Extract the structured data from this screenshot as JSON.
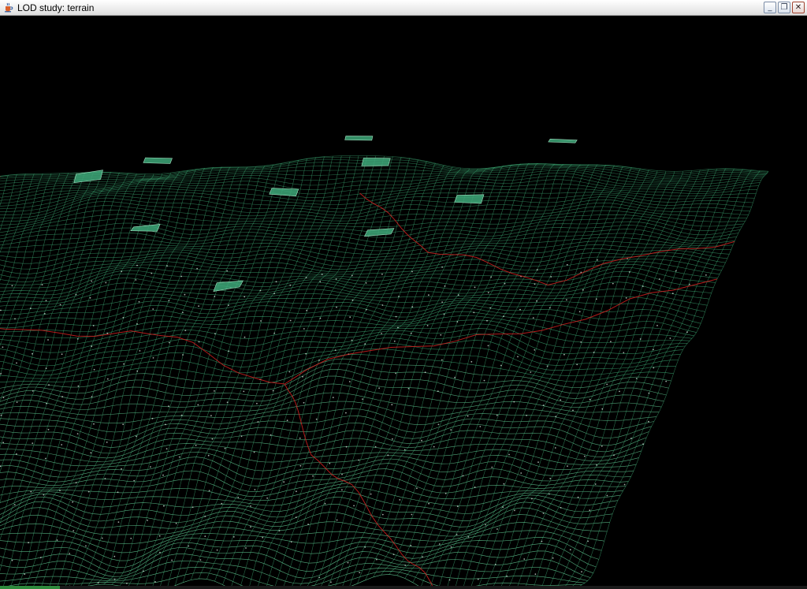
{
  "window": {
    "title": "LOD study: terrain",
    "controls": {
      "minimize_glyph": "_",
      "maximize_glyph": "❐",
      "close_glyph": "✕"
    }
  },
  "icons": {
    "app": "java-cup-icon",
    "minimize": "minimize-icon",
    "maximize": "restore-icon",
    "close": "close-icon"
  },
  "colors": {
    "background": "#000000",
    "wireframe": "#3fb27a",
    "wireframe_dense": "#66d39a",
    "highlight": "#e8f5ee",
    "lod_boundary": "#d12020",
    "peak_fill": "#3ea879"
  }
}
